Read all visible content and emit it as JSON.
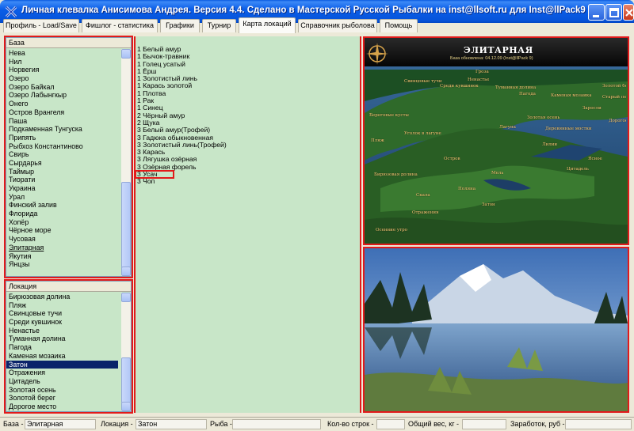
{
  "window": {
    "title": "Личная клевалка Анисимова Андрея. Версия 4.4. Сделано в Мастерской Русской Рыбалки на inst@llsoft.ru для Inst@llPack9"
  },
  "tabs": [
    {
      "label": "Профиль - Load/Save",
      "active": false
    },
    {
      "label": "Фишлог - статистика",
      "active": false
    },
    {
      "label": "Графики",
      "active": false
    },
    {
      "label": "Турнир",
      "active": false
    },
    {
      "label": "Карта локаций",
      "active": true
    },
    {
      "label": "Справочник рыболова",
      "active": false
    },
    {
      "label": "Помощь",
      "active": false
    }
  ],
  "bases": {
    "header": "База",
    "items": [
      "Нева",
      "Нил",
      "Норвегия",
      "Озеро",
      "Озеро Байкал",
      "Озеро Лабынгкыр",
      "Онего",
      "Остров Врангеля",
      "Паша",
      "Подкаменная Тунгуска",
      "Припять",
      "Рыбхоз Константиново",
      "Свирь",
      "Сырдарья",
      "Таймыр",
      "Тиорати",
      "Украина",
      "Урал",
      "Финский залив",
      "Флорида",
      "Хопёр",
      "Чёрное море",
      "Чусовая",
      "Элитарная",
      "Якутия",
      "Янцзы"
    ],
    "underlined": "Элитарная"
  },
  "locations": {
    "header": "Локация",
    "items": [
      "Бирюзовая долина",
      "Пляж",
      "Свинцовые тучи",
      "Среди кувшинок",
      "Ненастье",
      "Туманная долина",
      "Пагода",
      "Каменая мозаика",
      "Затон",
      "Отражения",
      "Цитадель",
      "Золотая осень",
      "Золотой берег",
      "Дорогое место"
    ],
    "selected": "Затон"
  },
  "fish": {
    "items": [
      "1 Белый амур",
      "1 Бычок-травник",
      "1 Голец усатый",
      "1 Ёрш",
      "1 Золотистый линь",
      "1 Карась золотой",
      "1 Плотва",
      "1 Рак",
      "1 Синец",
      "2 Чёрный амур",
      "2 Щука",
      "3 Белый амур(Трофей)",
      "3 Гадюка обыкновенная",
      "3 Золотистый линь(Трофей)",
      "3 Карась",
      "3 Лягушка озёрная",
      "3 Озёрная форель",
      "3 Усач",
      "3 Чоп"
    ],
    "highlighted": "3 Усач"
  },
  "map": {
    "title": "ЭЛИТАРНАЯ",
    "subtitle": "База обновлена: 04.12.09 (Inst@llPack 9)",
    "labels": [
      "Бирюзовая долина",
      "Пляж",
      "Свинцовые тучи",
      "Среди кувшинок",
      "Ненастье",
      "Туманная долина",
      "Пагода",
      "Каменая мозаика",
      "Затон",
      "Отражения",
      "Цитадель",
      "Золотая осень",
      "Золотой берег",
      "Дорогое место",
      "Береговые кусты",
      "Уголок в лагуне",
      "Деревянные мостки",
      "Осенние утро",
      "Остров",
      "Лагуна",
      "Поляна",
      "Скала",
      "Гроза",
      "Заросли",
      "Старый пень",
      "Лилии",
      "Мель",
      "Ясное"
    ]
  },
  "statusbar": {
    "base_label": "База -",
    "base_value": "Элитарная",
    "location_label": "Локация -",
    "location_value": "Затон",
    "fish_label": "Рыба -",
    "fish_value": "",
    "rows_label": "Кол-во строк -",
    "rows_value": "",
    "weight_label": "Общий вес, кг -",
    "weight_value": "",
    "earn_label": "Заработок, руб -",
    "earn_value": ""
  },
  "colors": {
    "accent_red": "#e21a1a",
    "list_green": "#c8e6c8",
    "selection": "#0a246a"
  }
}
